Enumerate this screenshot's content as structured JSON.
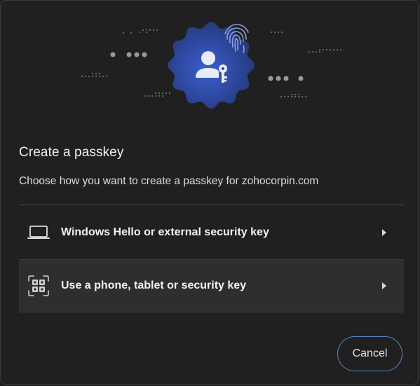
{
  "dialog": {
    "title": "Create a passkey",
    "subtitle": "Choose how you want to create a passkey for zohocorpin.com"
  },
  "options": [
    {
      "label": "Windows Hello or external security key",
      "icon": "laptop-icon"
    },
    {
      "label": "Use a phone, tablet or security key",
      "icon": "qr-code-icon"
    }
  ],
  "footer": {
    "cancel_label": "Cancel"
  },
  "colors": {
    "background": "#202020",
    "hero_badge": "#2f4fa8",
    "accent_border": "#5a86c8",
    "selected_row": "#2e2e2e"
  }
}
